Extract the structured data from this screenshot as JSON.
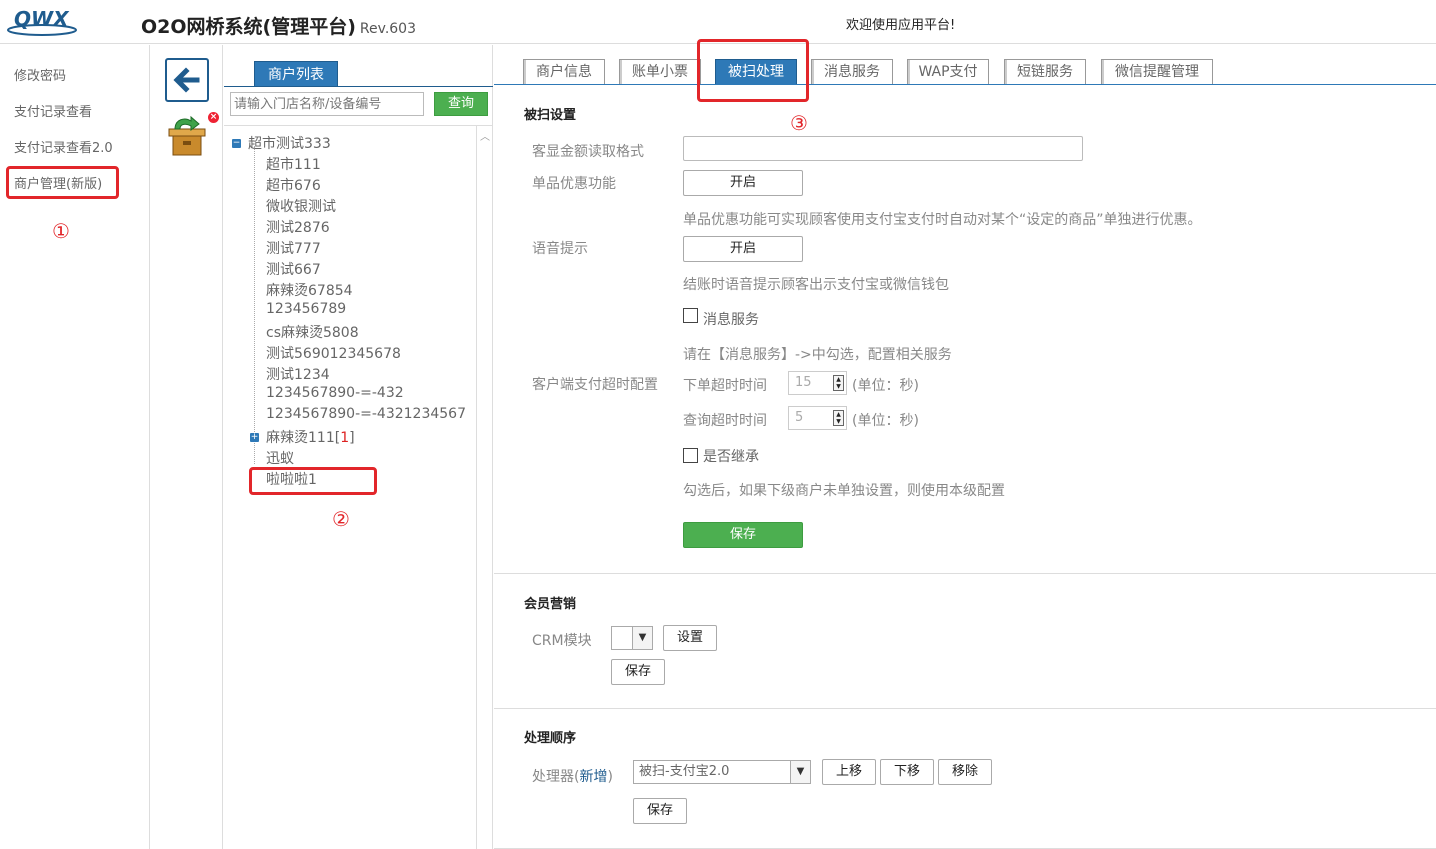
{
  "header": {
    "logo_text": "QWX",
    "title": "O2O网桥系统(管理平台)",
    "revision": "Rev.603",
    "welcome": "欢迎使用应用平台!"
  },
  "left_menu": {
    "items": [
      {
        "label": "修改密码"
      },
      {
        "label": "支付记录查看"
      },
      {
        "label": "支付记录查看2.0"
      },
      {
        "label": "商户管理(新版)"
      }
    ]
  },
  "icon_col": {
    "back_icon": "arrow-left-icon",
    "box_icon": "export-box-icon",
    "badge": "×"
  },
  "merchant_list": {
    "tab_label": "商户列表",
    "search_placeholder": "请输入门店名称/设备编号",
    "query_button": "查询",
    "root": {
      "label": "超市测试333",
      "toggle": "−"
    },
    "children": [
      "超市111",
      "超市676",
      "微收银测试",
      "测试2876",
      "测试777",
      "测试667",
      "麻辣烫67854",
      "123456789",
      "cs麻辣烫5808",
      "测试569012345678",
      "测试1234",
      "1234567890-=-432",
      "1234567890-=-4321234567"
    ],
    "collapsed_node": {
      "label": "麻辣烫111",
      "count_open": "[",
      "count": "1",
      "count_close": "]",
      "toggle": "+"
    },
    "extra_nodes": [
      "迅蚁",
      "啦啦啦1"
    ]
  },
  "annotations": {
    "one": "①",
    "two": "②",
    "three": "③"
  },
  "tabs": [
    {
      "label": "商户信息"
    },
    {
      "label": "账单小票"
    },
    {
      "label": "被扫处理"
    },
    {
      "label": "消息服务"
    },
    {
      "label": "WAP支付"
    },
    {
      "label": "短链服务"
    },
    {
      "label": "微信提醒管理"
    }
  ],
  "scan_settings": {
    "title": "被扫设置",
    "amount_format_label": "客显金额读取格式",
    "amount_format_value": "",
    "single_discount_label": "单品优惠功能",
    "single_discount_button": "开启",
    "single_discount_hint": "单品优惠功能可实现顾客使用支付宝支付时自动对某个“设定的商品”单独进行优惠。",
    "voice_label": "语音提示",
    "voice_button": "开启",
    "voice_hint": "结账时语音提示顾客出示支付宝或微信钱包",
    "message_service_checkbox": "消息服务",
    "message_service_hint": "请在【消息服务】->中勾选，配置相关服务",
    "timeout_label": "客户端支付超时配置",
    "order_timeout_label": "下单超时时间",
    "order_timeout_value": "15",
    "query_timeout_label": "查询超时时间",
    "query_timeout_value": "5",
    "unit": "(单位：秒)",
    "inherit_checkbox": "是否继承",
    "inherit_hint": "勾选后，如果下级商户未单独设置，则使用本级配置",
    "save_button": "保存"
  },
  "member_marketing": {
    "title": "会员营销",
    "crm_label": "CRM模块",
    "crm_value": "",
    "settings_button": "设置",
    "save_button": "保存"
  },
  "processing_order": {
    "title": "处理顺序",
    "processor_label": "处理器(",
    "add_link": "新增",
    "processor_label_close": ")",
    "processor_value": "被扫-支付宝2.0",
    "move_up": "上移",
    "move_down": "下移",
    "remove": "移除",
    "save_button": "保存"
  },
  "colors": {
    "accent": "#2e79b7",
    "green": "#4caf50",
    "annotation": "#e2262a"
  }
}
